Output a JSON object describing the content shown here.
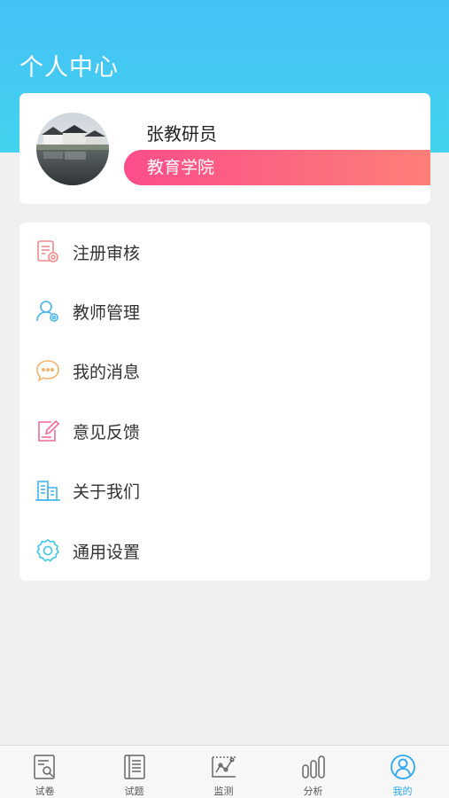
{
  "header": {
    "title": "个人中心"
  },
  "profile": {
    "name": "张教研员",
    "organization": "教育学院",
    "avatar_icon": "landscape-photo-avatar"
  },
  "menu": {
    "items": [
      {
        "label": "注册审核",
        "icon": "registration-review-icon",
        "color": "#f08a8a"
      },
      {
        "label": "教师管理",
        "icon": "teacher-management-icon",
        "color": "#45b4ef"
      },
      {
        "label": "我的消息",
        "icon": "message-icon",
        "color": "#f2b36b"
      },
      {
        "label": "意见反馈",
        "icon": "feedback-edit-icon",
        "color": "#f06a9a"
      },
      {
        "label": "关于我们",
        "icon": "building-icon",
        "color": "#45b4ef"
      },
      {
        "label": "通用设置",
        "icon": "settings-gear-icon",
        "color": "#3fc7e8"
      }
    ]
  },
  "tabbar": {
    "active_color": "#2aa8f0",
    "tabs": [
      {
        "label": "试卷",
        "icon": "exam-paper-icon",
        "active": false
      },
      {
        "label": "试题",
        "icon": "question-book-icon",
        "active": false
      },
      {
        "label": "监测",
        "icon": "monitor-chart-icon",
        "active": false
      },
      {
        "label": "分析",
        "icon": "analysis-bars-icon",
        "active": false
      },
      {
        "label": "我的",
        "icon": "user-profile-icon",
        "active": true
      }
    ]
  }
}
